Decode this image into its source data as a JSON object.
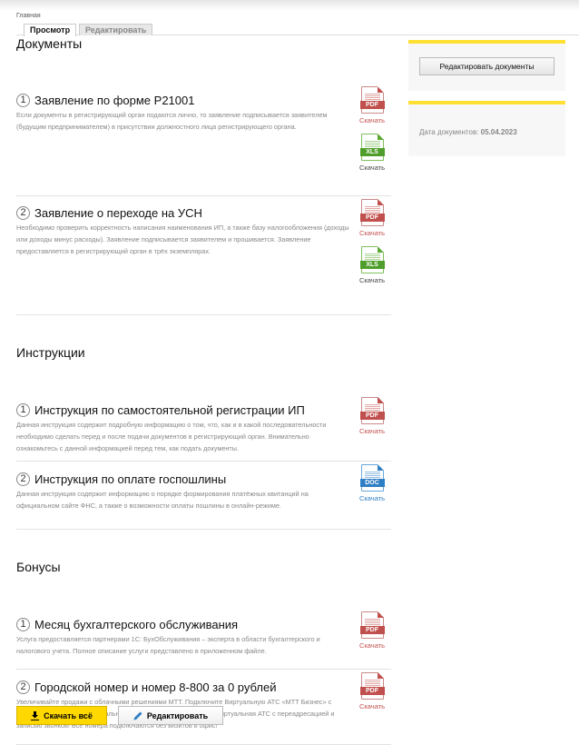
{
  "breadcrumb": "Главная",
  "tabs": [
    {
      "label": "Просмотр",
      "active": true
    },
    {
      "label": "Редактировать",
      "active": false
    }
  ],
  "sections": [
    {
      "title": "Документы",
      "items": [
        {
          "num": "1",
          "title": "Заявление по форме Р21001",
          "desc": "Если документы в регистрирующий орган подаются лично, то заявление подписывается заявителем (будущим предпринимателем) в присутствии должностного лица регистрирующего органа.",
          "files": [
            {
              "type": "pdf",
              "label": "PDF",
              "link": "Скачать"
            },
            {
              "type": "xls",
              "label": "XLS",
              "link": "Скачать"
            }
          ]
        },
        {
          "num": "2",
          "title": "Заявление о переходе на УСН",
          "desc": "Необходимо проверить корректность написания наименования ИП, а также базу налогообложения (доходы или доходы минус расходы). Заявление подписывается заявителем и прошивается. Заявление предоставляется в регистрирующий орган в трёх экземплярах.",
          "files": [
            {
              "type": "pdf",
              "label": "PDF",
              "link": "Скачать"
            },
            {
              "type": "xls",
              "label": "XLS",
              "link": "Скачать"
            }
          ]
        }
      ]
    },
    {
      "title": "Инструкции",
      "items": [
        {
          "num": "1",
          "title": "Инструкция по самостоятельной регистрации ИП",
          "desc": "Данная инструкция содержит подробную информацию о том, что, как и в какой последовательности необходимо сделать перед и после подачи документов в регистрирующий орган. Внимательно ознакомьтесь с данной информацией перед тем, как подать документы.",
          "files": [
            {
              "type": "pdf",
              "label": "PDF",
              "link": "Скачать"
            }
          ]
        },
        {
          "num": "2",
          "title": "Инструкция по оплате госпошлины",
          "desc": "Данная инструкция содержит информацию о порядке формирования платёжных квитанций на официальном сайте ФНС, а также о возможности оплаты пошлины в онлайн-режиме.",
          "files": [
            {
              "type": "doc",
              "label": "DOC",
              "link": "Скачать"
            }
          ]
        }
      ]
    },
    {
      "title": "Бонусы",
      "items": [
        {
          "num": "1",
          "title": "Месяц бухгалтерского обслуживания",
          "desc": "Услуга предоставляется партнерами 1С: БухОбслуживания – эксперта в области бухгалтерского и налогового учета. Полное описание услуги представлено в приложенном файле.",
          "files": [
            {
              "type": "pdf",
              "label": "PDF",
              "link": "Скачать"
            }
          ]
        },
        {
          "num": "2",
          "title": "Городской номер и номер 8-800 за 0 рублей",
          "desc": "Увеличивайте продажи с облачными решениями МТТ. Подключите Виртуальную АТС «МТТ Бизнес» с городским номером и федеральным номером 8800 за 0 рублей. Виртуальная АТС с переадресацией и записью звонков! Все номера подключаются без визитов в офис!",
          "files": [
            {
              "type": "pdf",
              "label": "PDF",
              "link": "Скачать"
            }
          ]
        }
      ]
    }
  ],
  "sidebar": {
    "edit_docs": "Редактировать документы",
    "date_label": "Дата документов:",
    "date_value": "05.04.2023",
    "accent": "#ffe033"
  },
  "buttons": {
    "download_all": "Скачать всё",
    "edit": "Редактировать",
    "download_color": "#ffd800"
  }
}
